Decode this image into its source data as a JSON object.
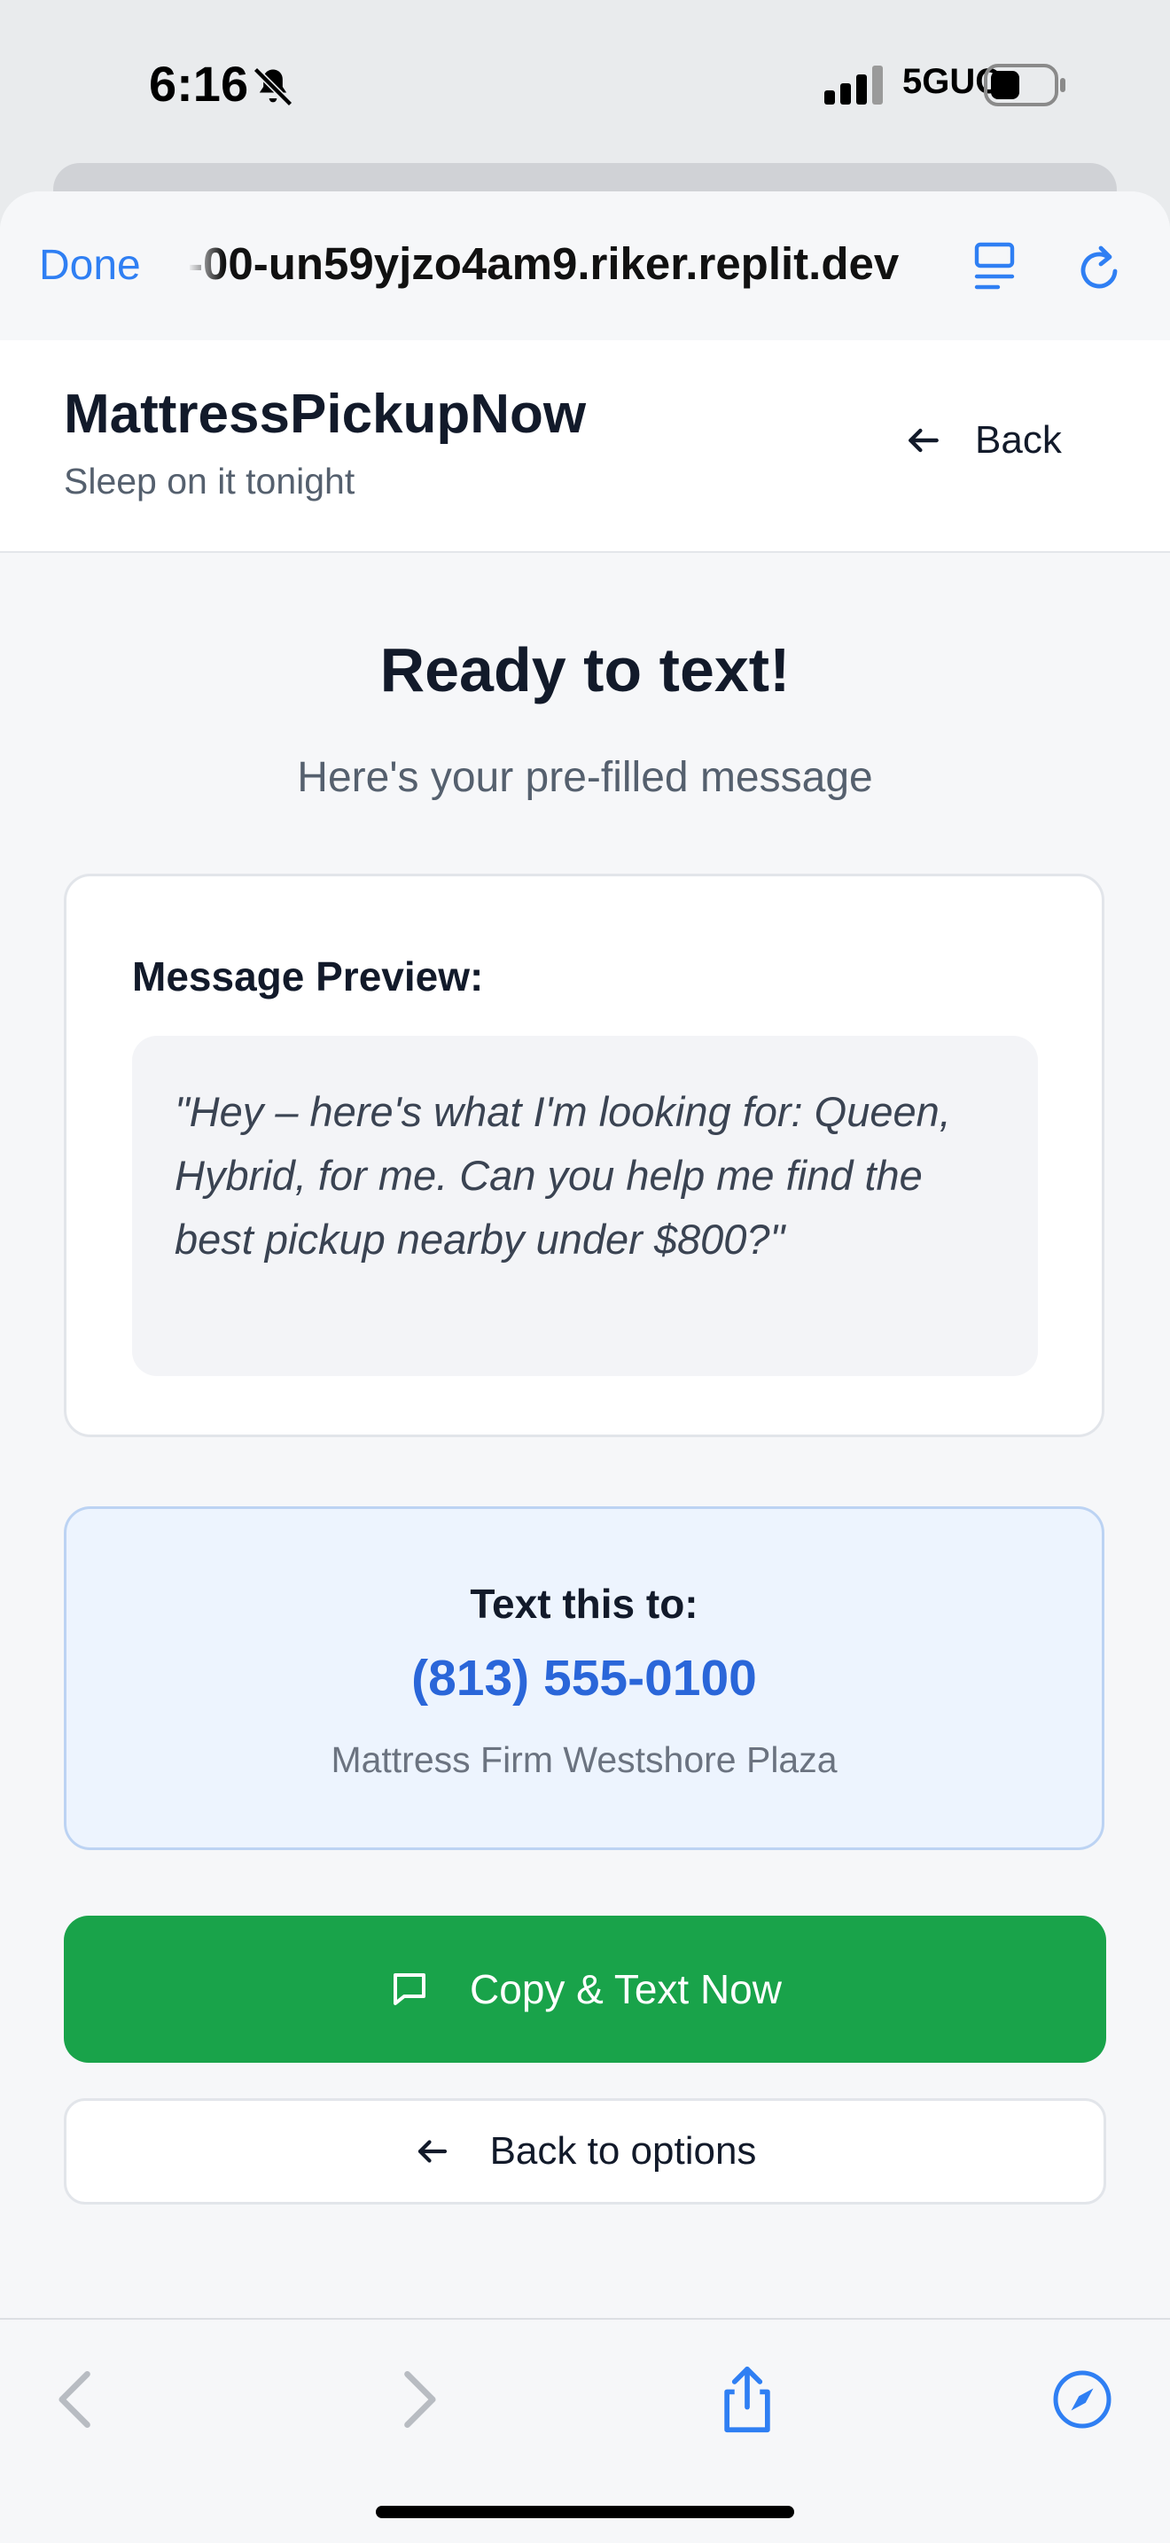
{
  "status": {
    "time": "6:16",
    "network": "5GUC"
  },
  "browser": {
    "done_label": "Done",
    "url": "-00-un59yjzo4am9.riker.replit.dev"
  },
  "header": {
    "brand": "MattressPickupNow",
    "tagline": "Sleep on it tonight",
    "back_label": "Back"
  },
  "main": {
    "title": "Ready to text!",
    "subtitle": "Here's your pre-filled message"
  },
  "preview": {
    "label": "Message Preview:",
    "message": "\"Hey – here's what I'm looking for: Queen, Hybrid, for me. Can you help me find the best pickup nearby under $800?\""
  },
  "sms": {
    "label": "Text this to:",
    "phone": "(813) 555-0100",
    "store": "Mattress Firm Westshore Plaza"
  },
  "actions": {
    "copy_text": "Copy & Text Now",
    "back_to_options": "Back to options"
  },
  "colors": {
    "accent": "#2f7ff3",
    "success": "#19a34a",
    "phone": "#2a66d9",
    "info_bg": "#edf4fe"
  },
  "icons": [
    "bell-slash-icon",
    "signal-icon",
    "battery-icon",
    "reader-icon",
    "reload-icon",
    "arrow-left-icon",
    "message-icon",
    "chevron-left-icon",
    "chevron-right-icon",
    "share-icon",
    "compass-icon"
  ]
}
